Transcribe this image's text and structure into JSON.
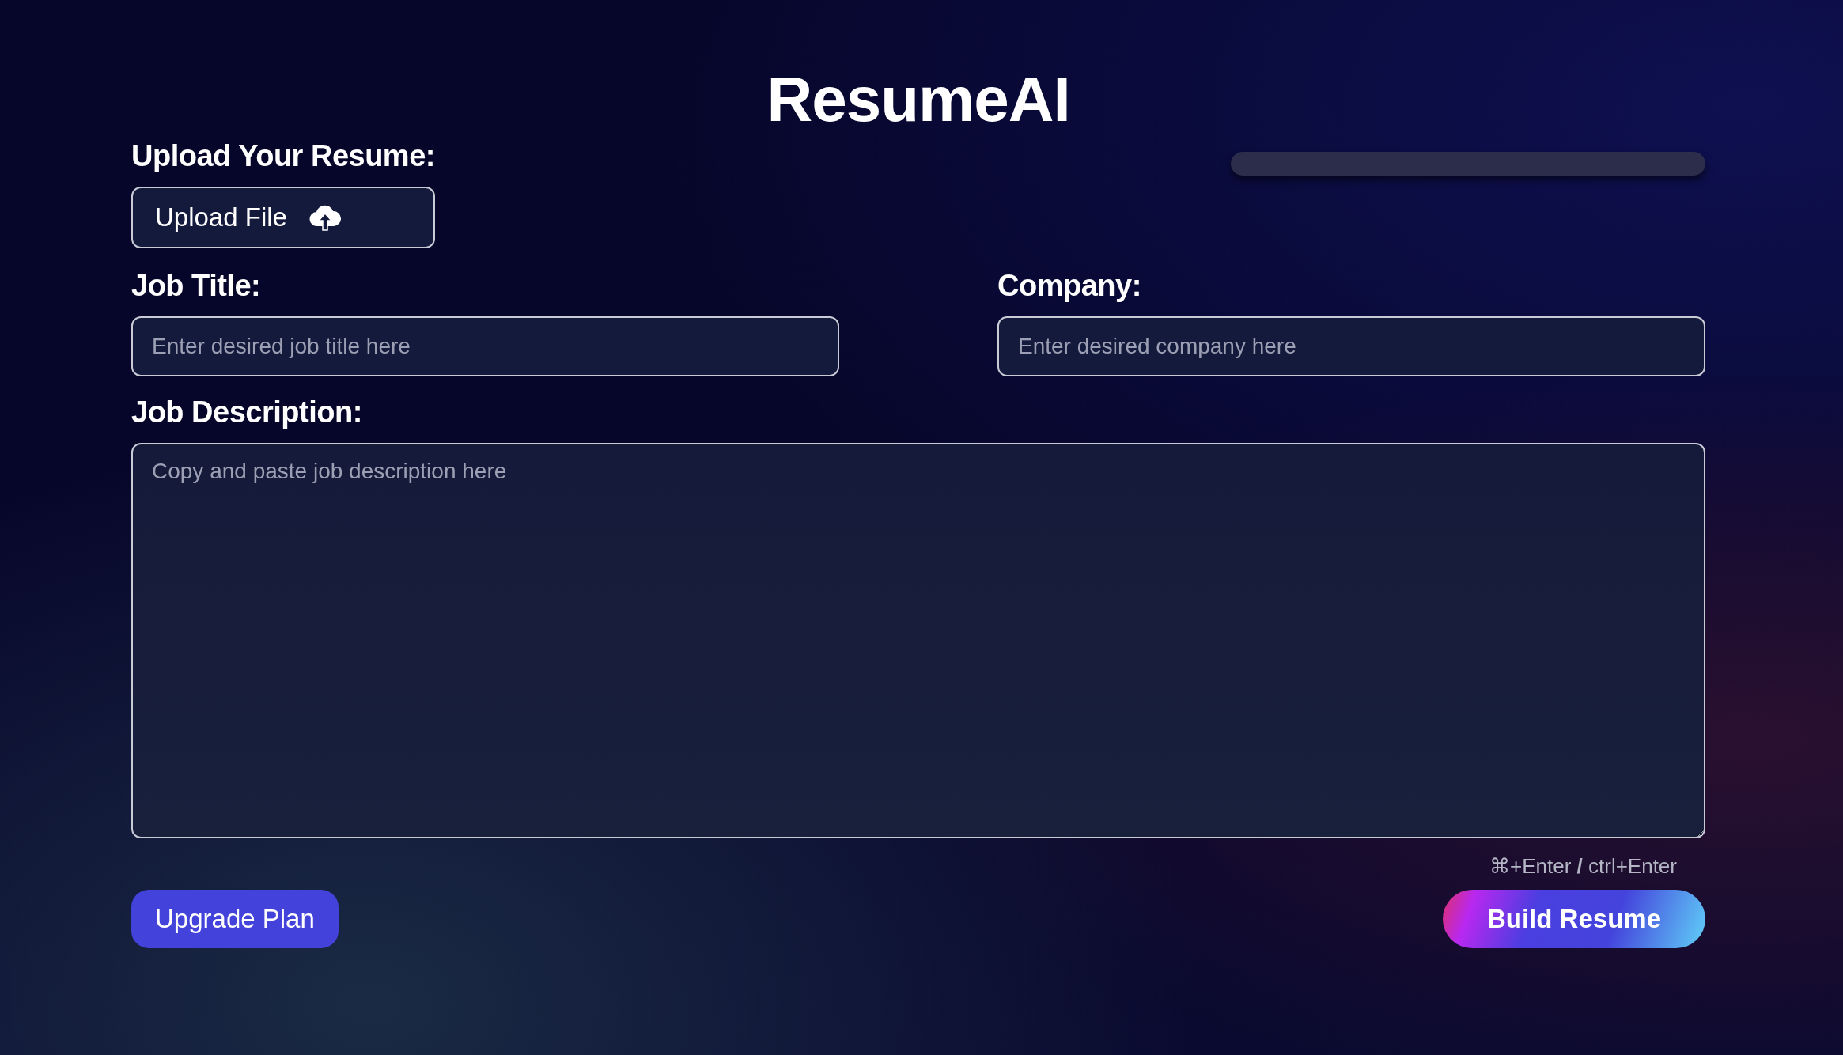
{
  "title": "ResumeAI",
  "upload": {
    "label": "Upload Your Resume:",
    "button": "Upload File"
  },
  "fields": [
    {
      "label": "Job Title:",
      "placeholder": "Enter desired job title here"
    },
    {
      "label": "Company:",
      "placeholder": "Enter desired company here"
    }
  ],
  "description": {
    "label": "Job Description:",
    "placeholder": "Copy and paste job description here"
  },
  "shortcut_hint": "⌘+Enter **/** ctrl+Enter",
  "buttons": [
    {
      "label": "Upgrade Plan",
      "kind": "upgrade"
    },
    {
      "label": "Build Resume",
      "kind": "build"
    }
  ]
}
